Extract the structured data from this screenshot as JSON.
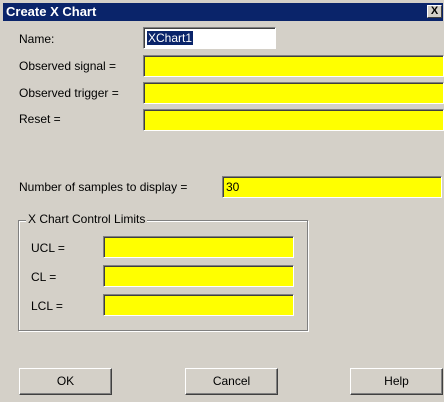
{
  "window": {
    "title": "Create X Chart",
    "close_glyph": "X",
    "close_icon": "close-icon"
  },
  "form": {
    "name_label": "Name:",
    "name_value": "XChart1",
    "observed_signal_label": "Observed signal =",
    "observed_signal_value": "",
    "observed_trigger_label": "Observed trigger =",
    "observed_trigger_value": "",
    "reset_label": "Reset =",
    "reset_value": "",
    "samples_label": "Number of samples to display =",
    "samples_value": "30"
  },
  "control_limits": {
    "title": "X Chart Control Limits",
    "ucl_label": "UCL =",
    "ucl_value": "",
    "cl_label": "CL =",
    "cl_value": "",
    "lcl_label": "LCL =",
    "lcl_value": ""
  },
  "buttons": {
    "ok": "OK",
    "cancel": "Cancel",
    "help": "Help"
  },
  "colors": {
    "field_highlight": "#ffff00",
    "titlebar": "#0a246a",
    "dialog_face": "#d4d0c8"
  }
}
